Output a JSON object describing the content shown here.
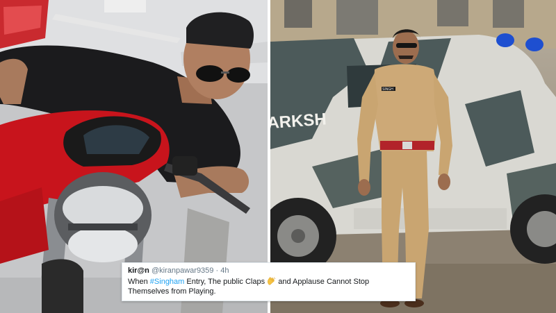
{
  "tweet": {
    "display_name": "kir@n",
    "handle": "@kiranpawar9359",
    "separator": "·",
    "time": "4h",
    "text_part1": "When ",
    "hashtag": "#Singham",
    "text_part2": " Entry, The public Claps ",
    "emoji_icon": "clapping-hands-icon",
    "text_part3": " and Applause Cannot Stop Themselves from Playing.",
    "link_color": "#1da1f2",
    "text_color": "#14171a",
    "meta_color": "#657786"
  },
  "vehicle_door_text": "ARKSH",
  "uniform_nameplate": "SINGH",
  "colors": {
    "motorcycle_red": "#c8141c",
    "uniform_khaki": "#c9a571",
    "vehicle_camo_light": "#d9d8d2",
    "vehicle_camo_dark": "#4c5a5a",
    "beacon_blue": "#1e4fd0"
  }
}
